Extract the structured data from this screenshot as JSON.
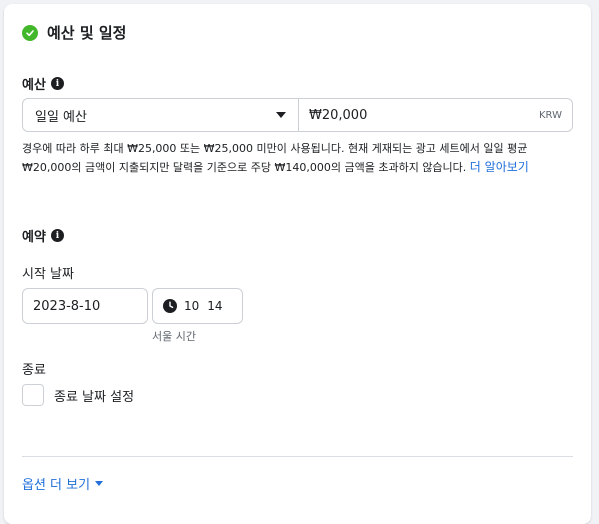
{
  "header": {
    "title": "예산 및 일정"
  },
  "budget": {
    "label": "예산",
    "type_value": "일일 예산",
    "amount_value": "₩20,000",
    "currency": "KRW",
    "help_text": "경우에 따라 하루 최대 ₩25,000 또는 ₩25,000 미만이 사용됩니다. 현재 게재되는 광고 세트에서 일일 평균 ₩20,000의 금액이 지출되지만 달력을 기준으로 주당 ₩140,000의 금액을 초과하지 않습니다.",
    "help_link": "더 알아보기"
  },
  "schedule": {
    "label": "예약",
    "start_label": "시작 날짜",
    "start_date": "2023-8-10",
    "start_hour": "10",
    "start_minute": "14",
    "timezone": "서울 시간",
    "end_label": "종료",
    "end_checkbox_label": "종료 날짜 설정"
  },
  "footer": {
    "more_options": "옵션 더 보기"
  },
  "colors": {
    "accent": "#216fdb",
    "success": "#42b72a"
  },
  "icons": {
    "header": "check-circle-icon",
    "info": "info-icon",
    "clock": "clock-icon",
    "dropdown": "caret-down-icon"
  }
}
